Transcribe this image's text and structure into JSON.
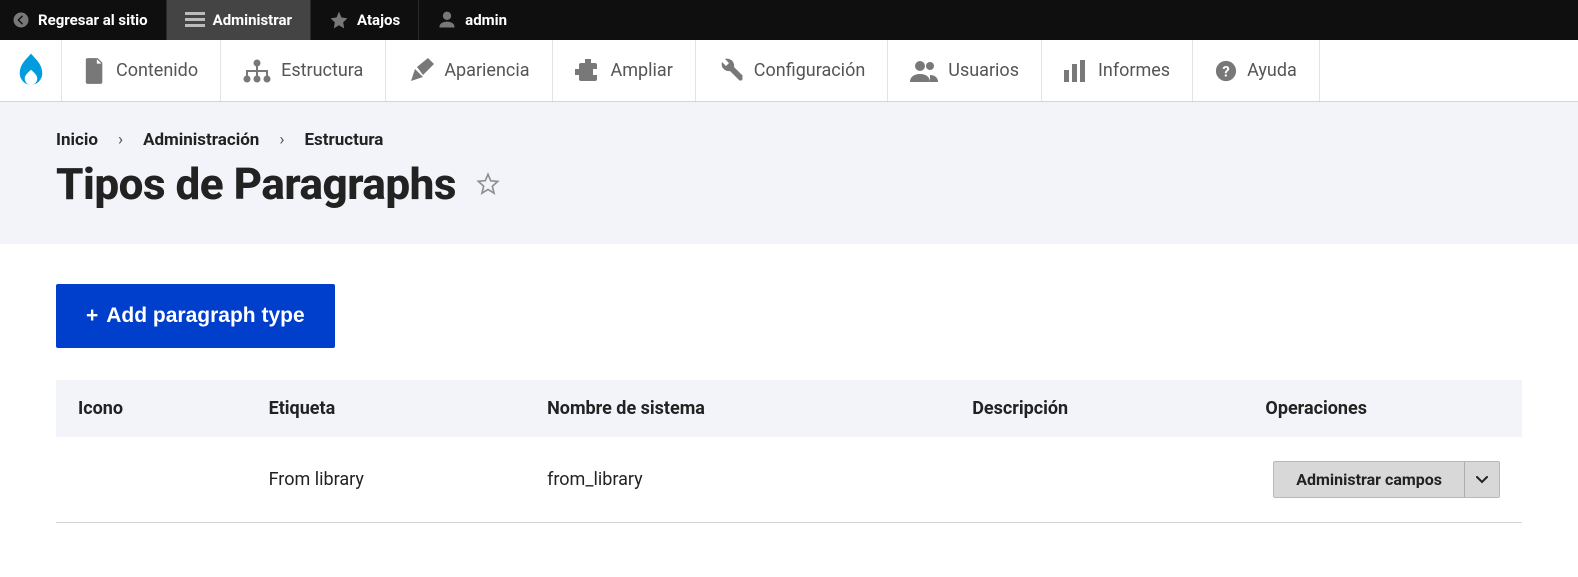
{
  "toolbar": {
    "back_label": "Regresar al sitio",
    "manage_label": "Administrar",
    "shortcuts_label": "Atajos",
    "user_label": "admin"
  },
  "admin_menu": {
    "content": "Contenido",
    "structure": "Estructura",
    "appearance": "Apariencia",
    "extend": "Ampliar",
    "config": "Configuración",
    "people": "Usuarios",
    "reports": "Informes",
    "help": "Ayuda"
  },
  "breadcrumb": {
    "home": "Inicio",
    "admin": "Administración",
    "structure": "Estructura"
  },
  "page_title": "Tipos de Paragraphs",
  "actions": {
    "add_label": "Add paragraph type"
  },
  "table": {
    "headers": {
      "icon": "Icono",
      "label": "Etiqueta",
      "machine": "Nombre de sistema",
      "desc": "Descripción",
      "ops": "Operaciones"
    },
    "rows": [
      {
        "icon": "",
        "label": "From library",
        "machine": "from_library",
        "desc": "",
        "op_label": "Administrar campos"
      }
    ]
  }
}
